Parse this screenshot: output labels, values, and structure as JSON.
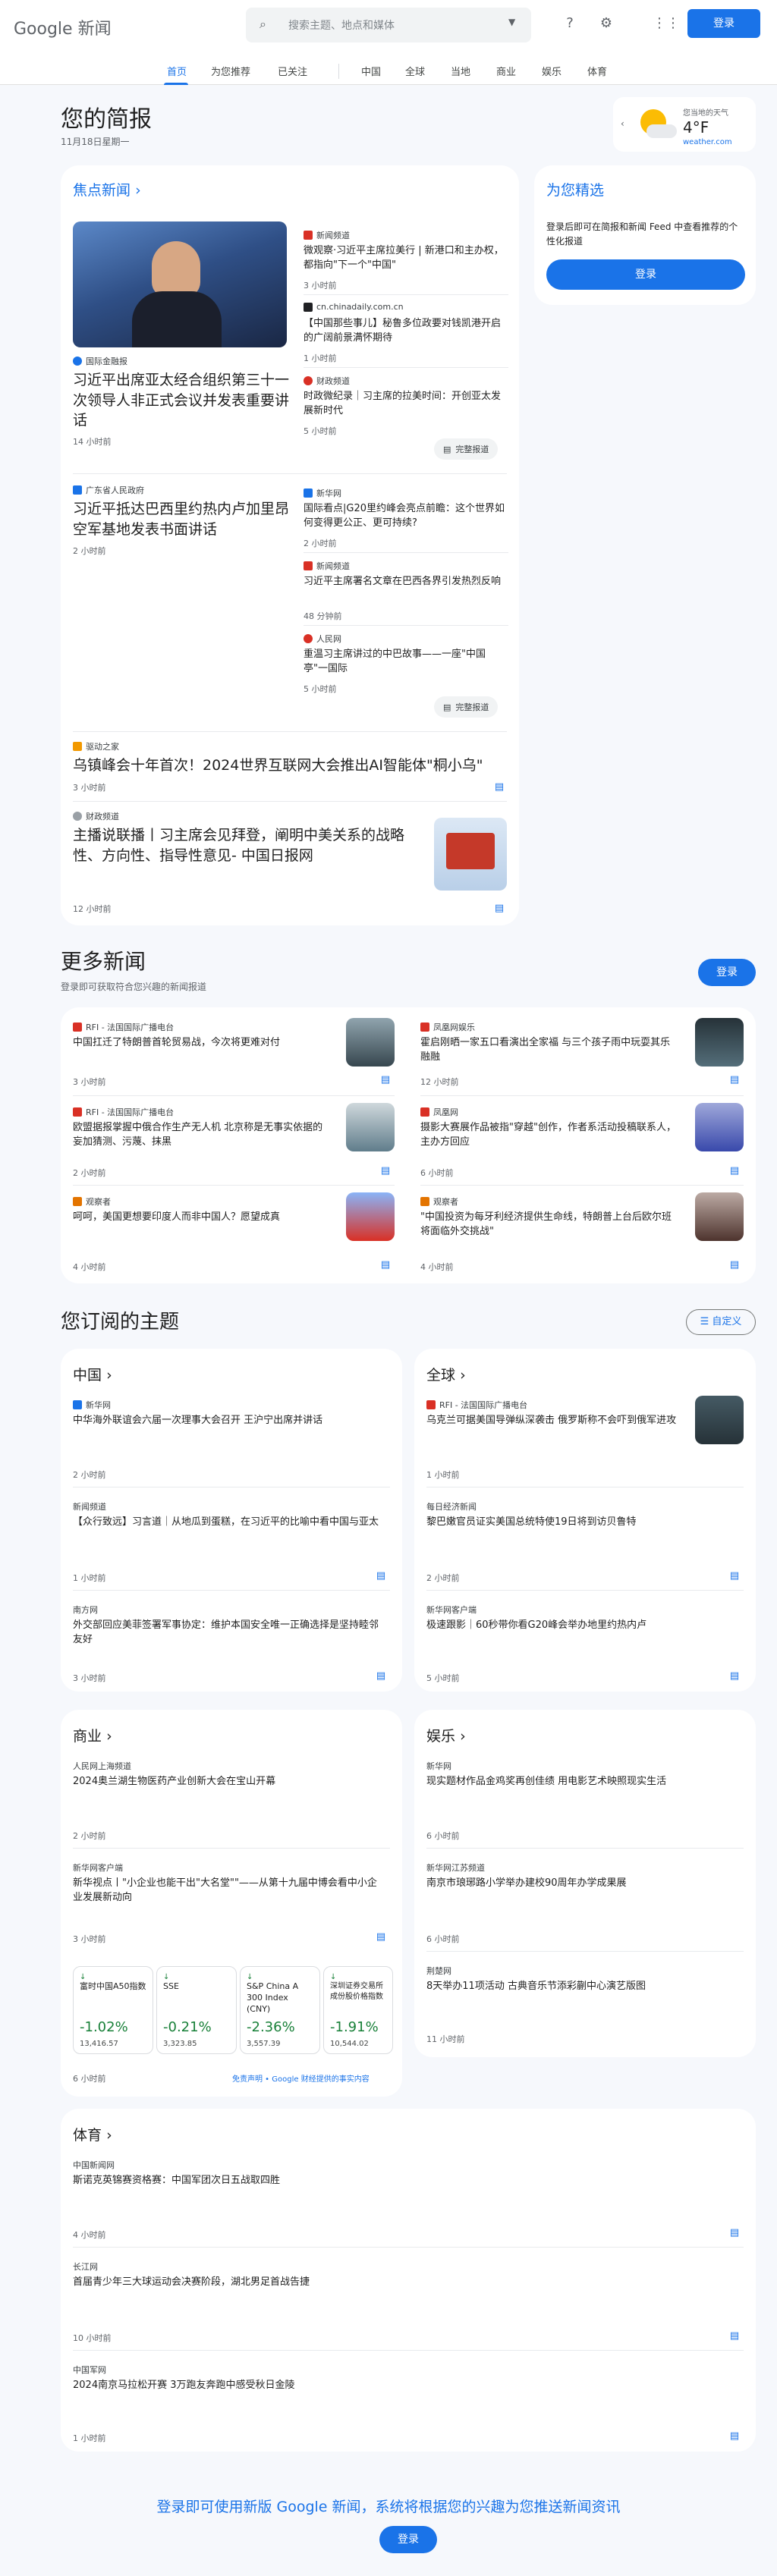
{
  "header": {
    "logo_google": "Google",
    "logo_news": "新闻",
    "search_placeholder": "搜索主题、地点和媒体",
    "signin": "登录"
  },
  "nav": [
    "首页",
    "为您推荐",
    "已关注",
    "中国",
    "全球",
    "当地",
    "商业",
    "娱乐",
    "体育"
  ],
  "briefing": {
    "title": "您的简报",
    "date": "11月18日星期一"
  },
  "weather": {
    "label": "您当地的天气",
    "temp": "4°F",
    "source": "weather.com"
  },
  "top": {
    "heading": "焦点新闻",
    "main": {
      "source": "国际金融报",
      "title": "习近平出席亚太经合组织第三十一次领导人非正式会议并发表重要讲话",
      "time": "14 小时前"
    },
    "side": [
      {
        "source": "新闻频道",
        "title": "微观察·习近平主席拉美行 | 新港口和主办权，都指向\"下一个\"中国\"",
        "time": "3 小时前"
      },
      {
        "source": "cn.chinadaily.com.cn",
        "title": "【中国那些事儿】秘鲁多位政要对钱凯港开启的广阔前景满怀期待",
        "time": "1 小时前"
      },
      {
        "source": "财政频道",
        "title": "时政微纪录｜习主席的拉美时间：开创亚太发展新时代",
        "time": "5 小时前"
      }
    ],
    "full1": "完整报道",
    "story2": {
      "source": "广东省人民政府",
      "title": "习近平抵达巴西里约热内卢加里昂空军基地发表书面讲话",
      "time": "2 小时前"
    },
    "side2": [
      {
        "source": "新华网",
        "title": "国际看点|G20里约峰会亮点前瞻：这个世界如何变得更公正、更可持续?",
        "time": "2 小时前"
      },
      {
        "source": "新闻频道",
        "title": "习近平主席署名文章在巴西各界引发热烈反响",
        "time": "48 分钟前"
      },
      {
        "source": "人民网",
        "title": "重温习主席讲过的中巴故事——一座\"中国亭\"一国际",
        "time": "5 小时前"
      }
    ],
    "full2": "完整报道",
    "story3": {
      "source": "驱动之家",
      "title": "乌镇峰会十年首次！2024世界互联网大会推出AI智能体\"桐小乌\"",
      "time": "3 小时前"
    },
    "story4": {
      "source": "财政频道",
      "title": "主播说联播丨习主席会见拜登，阐明中美关系的战略性、方向性、指导性意见- 中国日报网",
      "time": "12 小时前"
    }
  },
  "picks": {
    "title": "为您精选",
    "body": "登录后即可在简报和新闻 Feed 中查看推荐的个性化报道",
    "button": "登录"
  },
  "more": {
    "title": "更多新闻",
    "sub": "登录即可获取符合您兴趣的新闻报道",
    "button": "登录",
    "items": [
      {
        "source": "RFI - 法国国际广播电台",
        "title": "中国扛迁了特朗普首轮贸易战，今次将更难对付",
        "time": "3 小时前"
      },
      {
        "source": "凤凰网娱乐",
        "title": "霍启刚晒一家五口看演出全家福 与三个孩子雨中玩耍其乐融融",
        "time": "12 小时前"
      },
      {
        "source": "RFI - 法国国际广播电台",
        "title": "欧盟据报掌握中俄合作生产无人机 北京称是无事实依据的妄加猜测、污蔑、抹黑",
        "time": "2 小时前"
      },
      {
        "source": "凤凰网",
        "title": "摄影大赛展作品被指\"穿越\"创作，作者系活动投稿联系人，主办方回应",
        "time": "6 小时前"
      },
      {
        "source": "观察者",
        "title": "呵呵，美国更想要印度人而非中国人？愿望成真",
        "time": "4 小时前"
      },
      {
        "source": "观察者",
        "title": "\"中国投资为每牙利经济提供生命线，特朗普上台后欧尔班将面临外交挑战\"",
        "time": "4 小时前"
      }
    ]
  },
  "topics": {
    "title": "您订阅的主题",
    "customize": "自定义",
    "china": {
      "heading": "中国",
      "items": [
        {
          "source": "新华网",
          "title": "中华海外联谊会六届一次理事大会召开 王沪宁出席并讲话",
          "time": "2 小时前"
        },
        {
          "source": "新闻频道",
          "title": "【众行致远】习言道｜从地瓜到蛋糕，在习近平的比喻中看中国与亚太",
          "time": "1 小时前"
        },
        {
          "source": "南方网",
          "title": "外交部回应美菲签署军事协定：维护本国安全唯一正确选择是坚持睦邻友好",
          "time": "3 小时前"
        }
      ]
    },
    "global": {
      "heading": "全球",
      "items": [
        {
          "source": "RFI - 法国国际广播电台",
          "title": "乌克兰可据美国导弹纵深袭击 俄罗斯称不会吓到俄军进攻",
          "time": "1 小时前"
        },
        {
          "source": "每日经济新闻",
          "title": "黎巴嫩官员证实美国总统特使19日将到访贝鲁特",
          "time": "2 小时前"
        },
        {
          "source": "新华网客户端",
          "title": "极速跟影｜60秒带你看G20峰会举办地里约热内卢",
          "time": "5 小时前"
        }
      ]
    },
    "business": {
      "heading": "商业",
      "items": [
        {
          "source": "人民网上海频道",
          "title": "2024奥兰湖生物医药产业创新大会在宝山开幕",
          "time": "2 小时前"
        },
        {
          "source": "新华网客户端",
          "title": "新华视点丨\"小企业也能干出\"大名堂\"\"——从第十九届中博会看中小企业发展新动向",
          "time": "3 小时前"
        }
      ],
      "markets": [
        {
          "name": "富时中国A50指数",
          "change": "-1.02%",
          "value": "13,416.57"
        },
        {
          "name": "SSE",
          "change": "-0.21%",
          "value": "3,323.85"
        },
        {
          "name": "S&P China A 300 Index (CNY)",
          "change": "-2.36%",
          "value": "3,557.39"
        },
        {
          "name": "深圳证券交易所成份股价格指数",
          "change": "-1.91%",
          "value": "10,544.02"
        }
      ],
      "time": "6 小时前",
      "disclaimer": "免责声明 • Google 财经提供的事实内容"
    },
    "ent": {
      "heading": "娱乐",
      "items": [
        {
          "source": "新华网",
          "title": "现实题材作品金鸡奖再创佳绩 用电影艺术映照现实生活",
          "time": "6 小时前"
        },
        {
          "source": "新华网江苏频道",
          "title": "南京市琅琊路小学举办建校90周年办学成果展",
          "time": "6 小时前"
        },
        {
          "source": "荆楚网",
          "title": "8天举办11项活动 古典音乐节添彩蒯中心演艺版图",
          "time": "11 小时前"
        }
      ]
    },
    "sports": {
      "heading": "体育",
      "items": [
        {
          "source": "中国新闻网",
          "title": "斯诺克英锦赛资格赛：中国军团次日五战取四胜",
          "time": "4 小时前"
        },
        {
          "source": "长江网",
          "title": "首届青少年三大球运动会决赛阶段，湖北男足首战告捷",
          "time": "10 小时前"
        },
        {
          "source": "中国军网",
          "title": "2024南京马拉松开赛 3万跑友奔跑中感受秋日金陵",
          "time": "1 小时前"
        }
      ]
    }
  },
  "footer": {
    "text": "登录即可使用新版 Google 新闻，系统将根据您的兴趣为您推送新闻资讯",
    "button": "登录"
  }
}
